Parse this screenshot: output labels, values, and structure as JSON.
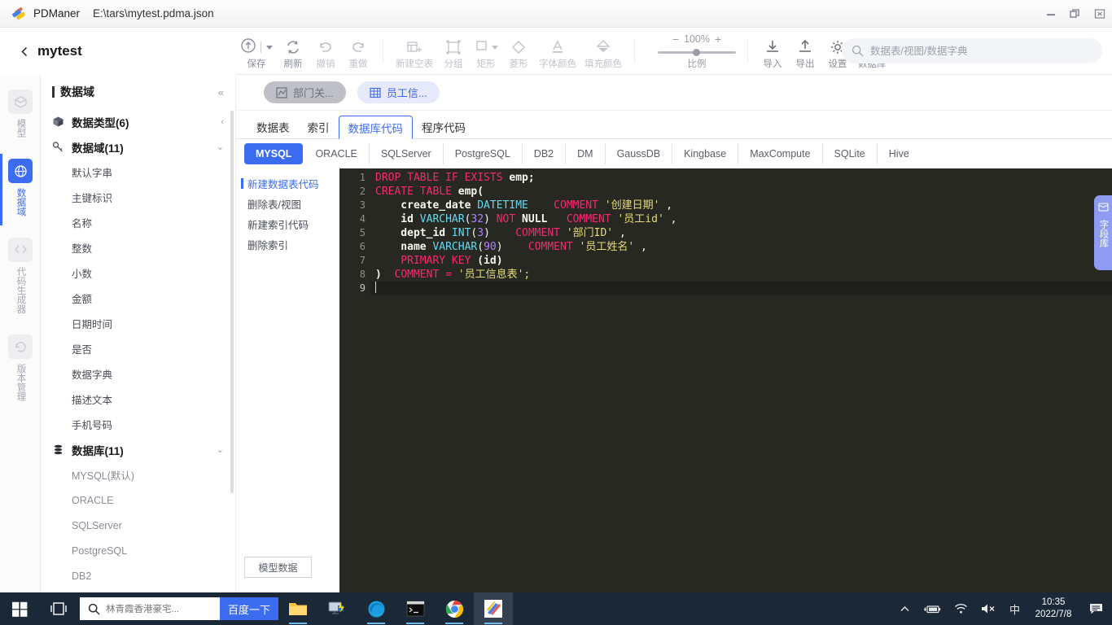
{
  "window": {
    "app_name": "PDManer",
    "file_path": "E:\\tars\\mytest.pdma.json",
    "logo_icon": "pdmaner-logo-icon",
    "minimize_icon": "minimize-icon",
    "maximize_icon": "maximize-icon",
    "close_icon": "close-icon"
  },
  "breadcrumb": {
    "back_icon": "chevron-left-icon",
    "project_name": "mytest"
  },
  "toolbar": {
    "items": [
      {
        "label": "保存",
        "icon": "save-cloud-icon",
        "has_caret": true
      },
      {
        "label": "刷新",
        "icon": "refresh-icon",
        "has_caret": false
      },
      {
        "label": "撤销",
        "icon": "undo-icon",
        "has_caret": false
      },
      {
        "label": "重做",
        "icon": "redo-icon",
        "has_caret": false
      }
    ],
    "shape_items": [
      {
        "label": "新建空表",
        "icon": "new-table-icon",
        "has_caret": false
      },
      {
        "label": "分组",
        "icon": "group-icon",
        "has_caret": false
      },
      {
        "label": "矩形",
        "icon": "rectangle-icon",
        "has_caret": true
      },
      {
        "label": "菱形",
        "icon": "diamond-icon",
        "has_caret": false
      },
      {
        "label": "字体颜色",
        "icon": "font-color-icon",
        "has_caret": false
      },
      {
        "label": "填充颜色",
        "icon": "fill-color-icon",
        "has_caret": false
      }
    ],
    "zoom": {
      "minus": "−",
      "value": "100%",
      "plus": "+",
      "label": "比例"
    },
    "right_items": [
      {
        "label": "导入",
        "icon": "import-icon"
      },
      {
        "label": "导出",
        "icon": "export-icon"
      },
      {
        "label": "设置",
        "icon": "gear-icon"
      },
      {
        "label": "数据库",
        "icon": "database-icon"
      }
    ]
  },
  "search": {
    "icon": "search-icon",
    "placeholder": "数据表/视图/数据字典",
    "value": ""
  },
  "rail": {
    "items": [
      {
        "label": "模型",
        "icon": "model-cube-icon",
        "active": false
      },
      {
        "label": "数据域",
        "icon": "globe-icon",
        "active": true
      },
      {
        "label": "代码生成器",
        "icon": "code-icon",
        "active": false
      },
      {
        "label": "版本管理",
        "icon": "history-icon",
        "active": false
      }
    ]
  },
  "tree": {
    "title": "数据域",
    "collapse_icon": "collapse-left-icon",
    "groups": [
      {
        "label": "数据类型(6)",
        "icon": "cube-icon",
        "chevron": "chevron-right-icon",
        "expanded": false,
        "children": []
      },
      {
        "label": "数据域(11)",
        "icon": "key-icon",
        "chevron": "chevron-down-icon",
        "expanded": true,
        "children": [
          "默认字串",
          "主键标识",
          "名称",
          "整数",
          "小数",
          "金额",
          "日期时间",
          "是否",
          "数据字典",
          "描述文本",
          "手机号码"
        ]
      },
      {
        "label": "数据库(11)",
        "icon": "database-stack-icon",
        "chevron": "chevron-down-icon",
        "expanded": true,
        "children": [
          "MYSQL(默认)",
          "ORACLE",
          "SQLServer",
          "PostgreSQL",
          "DB2"
        ]
      }
    ]
  },
  "main": {
    "chips": [
      {
        "label": "部门关...",
        "icon": "relation-diagram-icon",
        "active": false
      },
      {
        "label": "员工信...",
        "icon": "table-grid-icon",
        "active": true
      }
    ],
    "subtabs": [
      {
        "label": "数据表",
        "active": false
      },
      {
        "label": "索引",
        "active": false
      },
      {
        "label": "数据库代码",
        "active": true
      },
      {
        "label": "程序代码",
        "active": false
      }
    ],
    "db_tabs": [
      {
        "label": "MYSQL",
        "active": true
      },
      {
        "label": "ORACLE",
        "active": false
      },
      {
        "label": "SQLServer",
        "active": false
      },
      {
        "label": "PostgreSQL",
        "active": false
      },
      {
        "label": "DB2",
        "active": false
      },
      {
        "label": "DM",
        "active": false
      },
      {
        "label": "GaussDB",
        "active": false
      },
      {
        "label": "Kingbase",
        "active": false
      },
      {
        "label": "MaxCompute",
        "active": false
      },
      {
        "label": "SQLite",
        "active": false
      },
      {
        "label": "Hive",
        "active": false
      }
    ],
    "code_list": [
      {
        "label": "新建数据表代码",
        "active": true
      },
      {
        "label": "删除表/视图",
        "active": false
      },
      {
        "label": "新建索引代码",
        "active": false
      },
      {
        "label": "删除索引",
        "active": false
      }
    ],
    "model_data_button": "模型数据"
  },
  "editor": {
    "active_line": 9,
    "total_lines": 9,
    "line_numbers": [
      "1",
      "2",
      "3",
      "4",
      "5",
      "6",
      "7",
      "8",
      "9"
    ],
    "lines": [
      {
        "n": 1,
        "tokens": [
          {
            "t": "DROP TABLE IF EXISTS ",
            "c": "kw"
          },
          {
            "t": "emp;",
            "c": "idn"
          }
        ]
      },
      {
        "n": 2,
        "tokens": [
          {
            "t": "CREATE TABLE ",
            "c": "kw"
          },
          {
            "t": "emp(",
            "c": "idn"
          }
        ]
      },
      {
        "n": 3,
        "tokens": [
          {
            "t": "    create_date ",
            "c": "idn"
          },
          {
            "t": "DATETIME",
            "c": "typ"
          },
          {
            "t": "    ",
            "c": "pln"
          },
          {
            "t": "COMMENT ",
            "c": "cmt"
          },
          {
            "t": "'创建日期'",
            "c": "str"
          },
          {
            "t": " ,",
            "c": "pln"
          }
        ]
      },
      {
        "n": 4,
        "tokens": [
          {
            "t": "    id ",
            "c": "idn"
          },
          {
            "t": "VARCHAR",
            "c": "typ"
          },
          {
            "t": "(",
            "c": "pln"
          },
          {
            "t": "32",
            "c": "num"
          },
          {
            "t": ") ",
            "c": "pln"
          },
          {
            "t": "NOT ",
            "c": "kw"
          },
          {
            "t": "NULL",
            "c": "idn"
          },
          {
            "t": "   ",
            "c": "pln"
          },
          {
            "t": "COMMENT ",
            "c": "cmt"
          },
          {
            "t": "'员工id'",
            "c": "str"
          },
          {
            "t": " ,",
            "c": "pln"
          }
        ]
      },
      {
        "n": 5,
        "tokens": [
          {
            "t": "    dept_id ",
            "c": "idn"
          },
          {
            "t": "INT",
            "c": "typ"
          },
          {
            "t": "(",
            "c": "pln"
          },
          {
            "t": "3",
            "c": "num"
          },
          {
            "t": ")    ",
            "c": "pln"
          },
          {
            "t": "COMMENT ",
            "c": "cmt"
          },
          {
            "t": "'部门ID'",
            "c": "str"
          },
          {
            "t": " ,",
            "c": "pln"
          }
        ]
      },
      {
        "n": 6,
        "tokens": [
          {
            "t": "    name ",
            "c": "idn"
          },
          {
            "t": "VARCHAR",
            "c": "typ"
          },
          {
            "t": "(",
            "c": "pln"
          },
          {
            "t": "90",
            "c": "num"
          },
          {
            "t": ")    ",
            "c": "pln"
          },
          {
            "t": "COMMENT ",
            "c": "cmt"
          },
          {
            "t": "'员工姓名'",
            "c": "str"
          },
          {
            "t": " ,",
            "c": "pln"
          }
        ]
      },
      {
        "n": 7,
        "tokens": [
          {
            "t": "    PRIMARY KEY ",
            "c": "kw"
          },
          {
            "t": "(id)",
            "c": "idn"
          }
        ]
      },
      {
        "n": 8,
        "tokens": [
          {
            "t": ")  ",
            "c": "idn"
          },
          {
            "t": "COMMENT ",
            "c": "cmt"
          },
          {
            "t": "= ",
            "c": "op"
          },
          {
            "t": "'员工信息表';",
            "c": "str"
          }
        ]
      },
      {
        "n": 9,
        "tokens": []
      }
    ],
    "raw_text": "DROP TABLE IF EXISTS emp;\nCREATE TABLE emp(\n    create_date DATETIME    COMMENT '创建日期' ,\n    id VARCHAR(32) NOT NULL   COMMENT '员工id' ,\n    dept_id INT(3)    COMMENT '部门ID' ,\n    name VARCHAR(90)    COMMENT '员工姓名' ,\n    PRIMARY KEY (id)\n)  COMMENT = '员工信息表';\n"
  },
  "field_library": {
    "label": "字段库",
    "icon": "field-library-icon"
  },
  "taskbar": {
    "start_icon": "windows-start-icon",
    "taskview_icon": "task-view-icon",
    "search": {
      "icon": "search-icon",
      "value": "林青霞香港豪宅...",
      "button_label": "百度一下"
    },
    "apps": [
      {
        "icon": "file-explorer-icon",
        "running": true,
        "active": false
      },
      {
        "icon": "remote-desktop-icon",
        "running": false,
        "active": false
      },
      {
        "icon": "edge-browser-icon",
        "running": true,
        "active": false
      },
      {
        "icon": "terminal-icon",
        "running": true,
        "active": false
      },
      {
        "icon": "chrome-browser-icon",
        "running": true,
        "active": false
      },
      {
        "icon": "pdmaner-icon",
        "running": true,
        "active": true
      }
    ],
    "tray": [
      {
        "icon": "chevron-up-icon"
      },
      {
        "icon": "battery-icon"
      },
      {
        "icon": "wifi-icon"
      },
      {
        "icon": "volume-muted-icon"
      },
      {
        "icon": "ime-chinese-icon",
        "label": "中"
      }
    ],
    "clock": {
      "time": "10:35",
      "date": "2022/7/8"
    },
    "notification_icon": "notification-icon"
  },
  "colors": {
    "accent": "#3c6cf0",
    "editor_bg": "#272822",
    "taskbar_bg": "#1b2838",
    "baidu_blue": "#3c6cf0"
  }
}
